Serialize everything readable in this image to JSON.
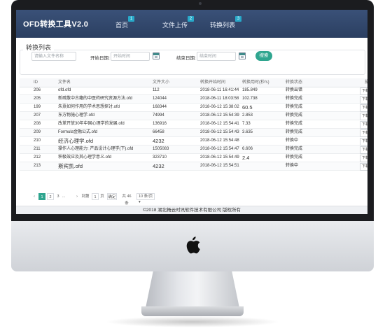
{
  "app": {
    "title": "OFD转换工具V2.0"
  },
  "nav": [
    {
      "label": "首页",
      "badge": "1"
    },
    {
      "label": "文件上传",
      "badge": "2"
    },
    {
      "label": "转换列表",
      "badge": "3"
    }
  ],
  "search": {
    "legend": "转换列表",
    "filename_placeholder": "请输入文件名称",
    "start_label": "开始日期:",
    "start_placeholder": "开始时间",
    "end_label": "结束日期:",
    "end_placeholder": "结束时间",
    "button": "搜索"
  },
  "table": {
    "headers": [
      "ID",
      "文件名",
      "文件大小",
      "转换开始时间",
      "转换用时(秒/s)",
      "转换状态",
      "操作"
    ],
    "rows": [
      {
        "id": "206",
        "name": "ofd.ofd",
        "size": "112",
        "start": "2018-06-11 16:41:44",
        "duration": "185.849",
        "status": "转换出错",
        "action": "下载"
      },
      {
        "id": "205",
        "name": "新疏散中古籍的中医药研究资源方法.ofd",
        "size": "124044",
        "start": "2018-06-11 18:03:58",
        "duration": "102.738",
        "status": "转换完成",
        "action": "下载"
      },
      {
        "id": "199",
        "name": "朱熹如何作用的学术思想探讨.ofd",
        "size": "168344",
        "start": "2018-06-12 15:38:02",
        "duration": "60.5",
        "status": "转换完成",
        "action": "下载"
      },
      {
        "id": "207",
        "name": "东方物施心理学.ofd",
        "size": "74994",
        "start": "2018-06-12 15:54:39",
        "duration": "2.853",
        "status": "转换完成",
        "action": "下载"
      },
      {
        "id": "208",
        "name": "改革开放30年中国心理学的发展.ofd",
        "size": "136916",
        "start": "2018-06-12 15:54:41",
        "duration": "7.33",
        "status": "转换完成",
        "action": "下载"
      },
      {
        "id": "209",
        "name": "Formula金融公式.ofd",
        "size": "66458",
        "start": "2018-06-12 15:54:43",
        "duration": "3.635",
        "status": "转换完成",
        "action": "下载"
      },
      {
        "id": "210",
        "name": "经济心理学.ofd",
        "size": "4232",
        "start": "2018-06-12 15:54:48",
        "duration": "",
        "status": "转换中",
        "action": "下载"
      },
      {
        "id": "211",
        "name": "操作人心理能力: 产品设计心理学(下).ofd",
        "size": "1505083",
        "start": "2018-06-12 15:54:47",
        "duration": "6.606",
        "status": "转换完成",
        "action": "下载"
      },
      {
        "id": "212",
        "name": "积极效应及其心理学意义.ofd",
        "size": "323710",
        "start": "2018-06-12 15:54:49",
        "duration": "2.4",
        "status": "转换完成",
        "action": "下载"
      },
      {
        "id": "213",
        "name": "斯宾凯.ofd",
        "size": "4232",
        "start": "2018-06-12 15:54:51",
        "duration": "",
        "status": "转换中",
        "action": "下载"
      }
    ]
  },
  "pagination": {
    "prev": "‹",
    "pages": [
      "1",
      "2",
      "3"
    ],
    "ellipsis": "...",
    "next": "›",
    "goto_label": "到第",
    "goto_value": "1",
    "page_unit": "页",
    "confirm": "确定",
    "total": "共 46 条",
    "page_size": "10 条/页"
  },
  "footer": {
    "text": "©2018 湖北畅云时讯软件技术有限公司 版权所有"
  }
}
